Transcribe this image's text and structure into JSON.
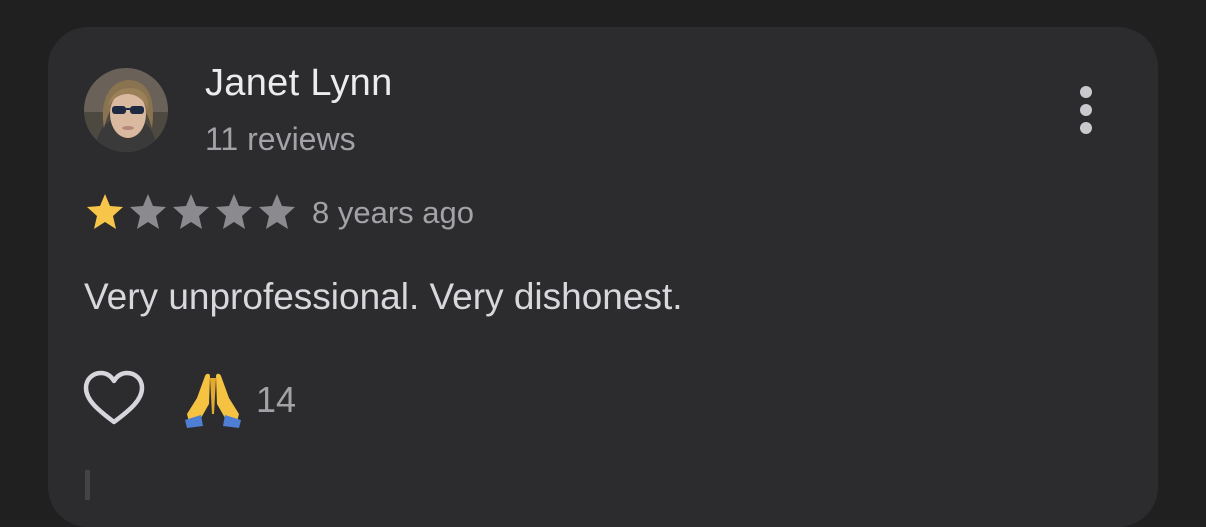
{
  "review": {
    "author": {
      "name": "Janet Lynn",
      "reviews": "11 reviews"
    },
    "rating": 1,
    "max_rating": 5,
    "time_ago": "8 years ago",
    "text": "Very unprofessional. Very dishonest.",
    "reactions": {
      "count": "14"
    }
  },
  "colors": {
    "background": "#202021",
    "card": "#2c2c2e",
    "star_filled": "#f6c54a",
    "star_empty": "#8a8a8f"
  },
  "icons": {
    "more": "vertical-dots-icon",
    "like": "heart-outline-icon",
    "reaction": "folded-hands-emoji"
  }
}
